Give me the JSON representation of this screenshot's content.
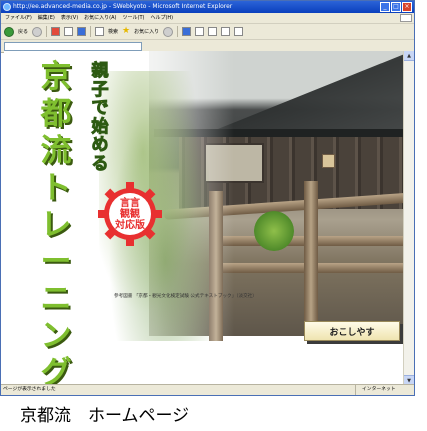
{
  "window": {
    "title": "http://ee.advanced-media.co.jp - SWebkyoto - Microsoft Internet Explorer",
    "minimize": "_",
    "maximize": "□",
    "close": "×"
  },
  "menu": [
    "ファイル(F)",
    "編集(E)",
    "表示(V)",
    "お気に入り(A)",
    "ツール(T)",
    "ヘルプ(H)"
  ],
  "toolbar": {
    "back": "戻る",
    "search": "検索",
    "favorites": "お気に入り"
  },
  "address": {
    "url": ""
  },
  "page": {
    "title_vertical": "京都流トレーニング",
    "subtitle_vertical": "親子で始める",
    "badge_lines": [
      "言言",
      "観観",
      "対応版"
    ],
    "reference": "参考図書 「京都・観光文化検定試験 公式テキストブック」（淡交社）",
    "enter_button": "おこしやす"
  },
  "status": {
    "left": "ページが表示されました",
    "right": "インターネット"
  },
  "caption": "京都流　ホームページ",
  "colors": {
    "title_bar": "#0a3fbd",
    "title_green": "#7fbf2f",
    "subtitle_yellow": "#e8e020",
    "badge_red": "#e83030"
  }
}
